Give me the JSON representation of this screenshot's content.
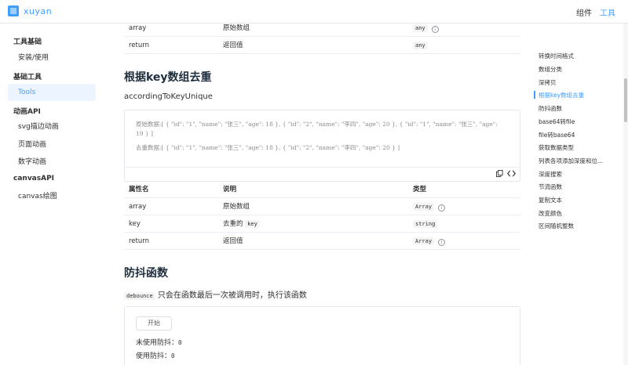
{
  "header": {
    "logo_text": "xuyan",
    "nav": [
      {
        "label": "组件",
        "active": false
      },
      {
        "label": "工具",
        "active": true
      }
    ]
  },
  "sidebar": {
    "groups": [
      {
        "title": "工具基础",
        "items": [
          {
            "label": "安装/使用",
            "active": false
          }
        ]
      },
      {
        "title": "基础工具",
        "items": [
          {
            "label": "Tools",
            "active": true
          }
        ]
      },
      {
        "title": "动画API",
        "items": [
          {
            "label": "svg描边动画",
            "active": false
          },
          {
            "label": "页面动画",
            "active": false
          },
          {
            "label": "数字动画",
            "active": false
          }
        ]
      },
      {
        "title": "canvasAPI",
        "items": [
          {
            "label": "canvas绘图",
            "active": false
          }
        ]
      }
    ]
  },
  "top_table": {
    "rows": [
      {
        "name": "array",
        "desc": "原始数组",
        "type": "any",
        "info": true
      },
      {
        "name": "return",
        "desc": "返回值",
        "type": "any",
        "info": false
      }
    ]
  },
  "section_unique": {
    "title": "根据key数组去重",
    "subtitle": "accordingToKeyUnique",
    "code_line1": "原始数据:[ { \"id\": \"1\", \"name\": \"张三\", \"age\": 18 }, { \"id\": \"2\", \"name\": \"李四\", \"age\": 20 }, { \"id\": \"1\", \"name\": \"张三\", \"age\":",
    "code_line2": "19 } ]",
    "code_line3": "去重数据:[ { \"id\": \"1\", \"name\": \"张三\", \"age\": 18 }, { \"id\": \"2\", \"name\": \"李四\", \"age\": 20 } ]",
    "table_headers": {
      "name": "属性名",
      "desc": "说明",
      "type": "类型"
    },
    "rows": [
      {
        "name": "array",
        "desc": "原始数组",
        "type": "Array",
        "info": true
      },
      {
        "name": "key",
        "desc": "去重的",
        "desc_code": "key",
        "type": "string",
        "info": false
      },
      {
        "name": "return",
        "desc": "返回值",
        "type": "Array",
        "info": true
      }
    ]
  },
  "section_debounce": {
    "title": "防抖函数",
    "desc_code": "debounce",
    "desc_text": "只会在函数最后一次被调用时，执行该函数",
    "button_label": "开始",
    "line1_label": "未使用防抖：",
    "line1_value": "0",
    "line2_label": "使用防抖：",
    "line2_value": "0"
  },
  "toc": {
    "items": [
      {
        "label": "转换时间格式",
        "active": false
      },
      {
        "label": "数组分类",
        "active": false
      },
      {
        "label": "深拷贝",
        "active": false
      },
      {
        "label": "根据key数组去重",
        "active": true
      },
      {
        "label": "防抖函数",
        "active": false
      },
      {
        "label": "base64转file",
        "active": false
      },
      {
        "label": "file转base64",
        "active": false
      },
      {
        "label": "获取数据类型",
        "active": false
      },
      {
        "label": "列表各项添加深度和位...",
        "active": false
      },
      {
        "label": "深度搜索",
        "active": false
      },
      {
        "label": "节流函数",
        "active": false
      },
      {
        "label": "复制文本",
        "active": false
      },
      {
        "label": "改变颜色",
        "active": false
      },
      {
        "label": "区间随机整数",
        "active": false
      }
    ]
  },
  "colors": {
    "accent": "#409eff",
    "text": "#303133",
    "border": "#ebeef5"
  }
}
